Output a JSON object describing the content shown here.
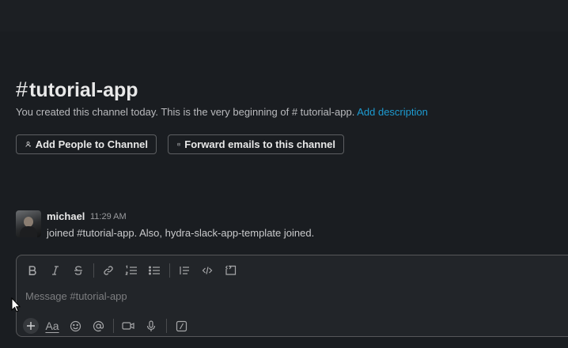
{
  "channel": {
    "hash": "#",
    "name": "tutorial-app",
    "intro_text": "You created this channel today. This is the very beginning of # tutorial-app.",
    "intro_link": "Add description"
  },
  "actions": {
    "add_people": "Add People to Channel",
    "forward_emails": "Forward emails to this channel"
  },
  "message": {
    "author": "michael",
    "time": "11:29 AM",
    "text": "joined #tutorial-app. Also, hydra-slack-app-template joined."
  },
  "composer": {
    "placeholder": "Message #tutorial-app",
    "text_format_label": "Aa",
    "toolbar_icons": [
      "bold-icon",
      "italic-icon",
      "strikethrough-icon",
      "link-icon",
      "ordered-list-icon",
      "bulleted-list-icon",
      "blockquote-icon",
      "code-icon",
      "code-block-icon"
    ],
    "bottom_icons": [
      "plus-icon",
      "text-format-icon",
      "emoji-icon",
      "mention-icon",
      "video-icon",
      "microphone-icon",
      "slash-command-icon"
    ]
  },
  "colors": {
    "background": "#1a1d21",
    "link": "#1d9bd1",
    "composer_bg": "#222529"
  }
}
